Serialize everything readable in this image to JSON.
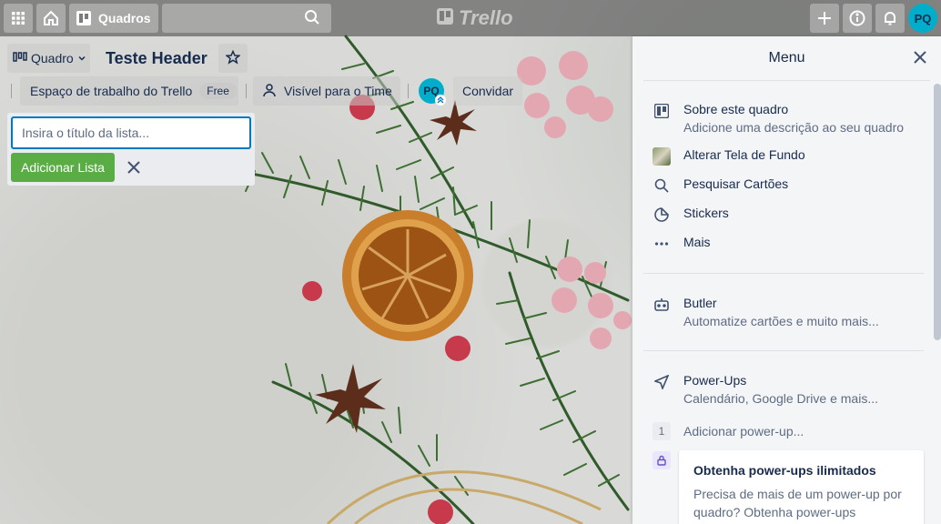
{
  "header": {
    "apps_icon": "grid-icon",
    "home_icon": "home-icon",
    "boards_label": "Quadros",
    "search_placeholder": "",
    "logo_text": "Trello",
    "create_icon": "plus-icon",
    "info_icon": "info-icon",
    "notifications_icon": "bell-icon",
    "avatar_initials": "PQ"
  },
  "board": {
    "view_label": "Quadro",
    "title": "Teste Header",
    "workspace_label": "Espaço de trabalho do Trello",
    "workspace_badge": "Free",
    "visibility_label": "Visível para o Time",
    "member_initials": "PQ",
    "invite_label": "Convidar"
  },
  "composer": {
    "placeholder": "Insira o título da lista...",
    "add_button": "Adicionar Lista"
  },
  "menu": {
    "title": "Menu",
    "about": {
      "title": "Sobre este quadro",
      "subtitle": "Adicione uma descrição ao seu quadro"
    },
    "background": "Alterar Tela de Fundo",
    "search_cards": "Pesquisar Cartões",
    "stickers": "Stickers",
    "more": "Mais",
    "butler": {
      "title": "Butler",
      "subtitle": "Automatize cartões e muito mais..."
    },
    "powerups": {
      "title": "Power-Ups",
      "subtitle": "Calendário, Google Drive e mais..."
    },
    "powerup_count": "1",
    "add_powerup": "Adicionar power-up...",
    "promo": {
      "title": "Obtenha power-ups ilimitados",
      "text": "Precisa de mais de um power-up por quadro? Obtenha power-ups"
    }
  },
  "colors": {
    "accent_blue": "#0079bf",
    "add_green": "#5aac44",
    "avatar_teal": "#00aecc"
  }
}
